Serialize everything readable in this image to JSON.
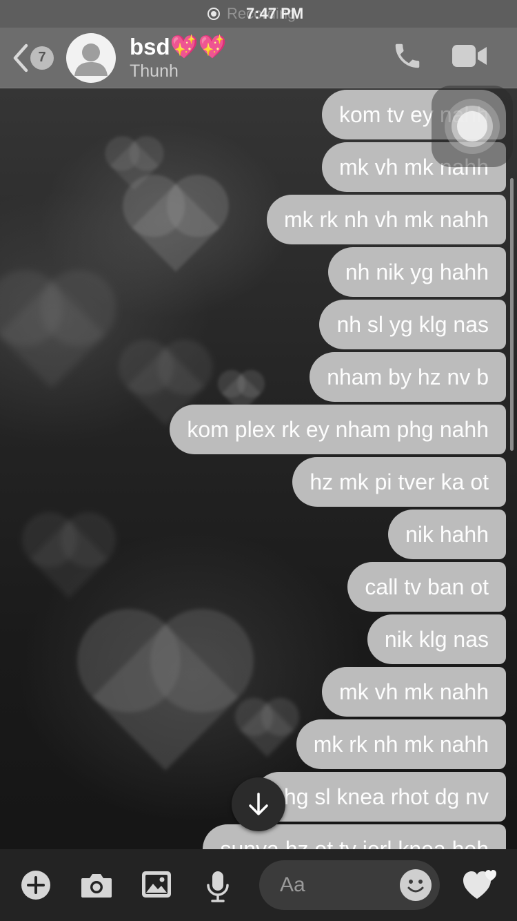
{
  "status_bar": {
    "time": "7:47 PM",
    "recording_label": "Recording"
  },
  "header": {
    "back_badge_count": "7",
    "contact_name": "bsd💖💖",
    "contact_subtitle": "Thunh",
    "actions": [
      "phone-icon",
      "video-camera-icon"
    ]
  },
  "messages": [
    {
      "text": "kom tv ey nahh"
    },
    {
      "text": "mk vh mk nahh"
    },
    {
      "text": "mk rk nh vh mk nahh"
    },
    {
      "text": "nh nik yg hahh"
    },
    {
      "text": "nh sl yg klg nas"
    },
    {
      "text": "nham by hz nv b"
    },
    {
      "text": "kom plex rk ey nham phg nahh"
    },
    {
      "text": "hz mk pi tver ka ot"
    },
    {
      "text": "nik hahh"
    },
    {
      "text": "call tv ban ot"
    },
    {
      "text": "nik klg nas"
    },
    {
      "text": "mk vh mk nahh"
    },
    {
      "text": "mk rk nh mk nahh"
    },
    {
      "text": "nhg sl knea rhot dg nv"
    },
    {
      "text": "sunya hz ot tv jorl knea hoh"
    }
  ],
  "composer": {
    "placeholder": "Aa",
    "icons": [
      "plus-icon",
      "camera-icon",
      "gallery-icon",
      "microphone-icon",
      "emoji-icon",
      "heart-reaction-icon"
    ]
  },
  "colors": {
    "bubble": "#bcbcbc",
    "header": "#6d6d6d",
    "status_bar": "#5e5e5e",
    "composer": "#232323"
  }
}
